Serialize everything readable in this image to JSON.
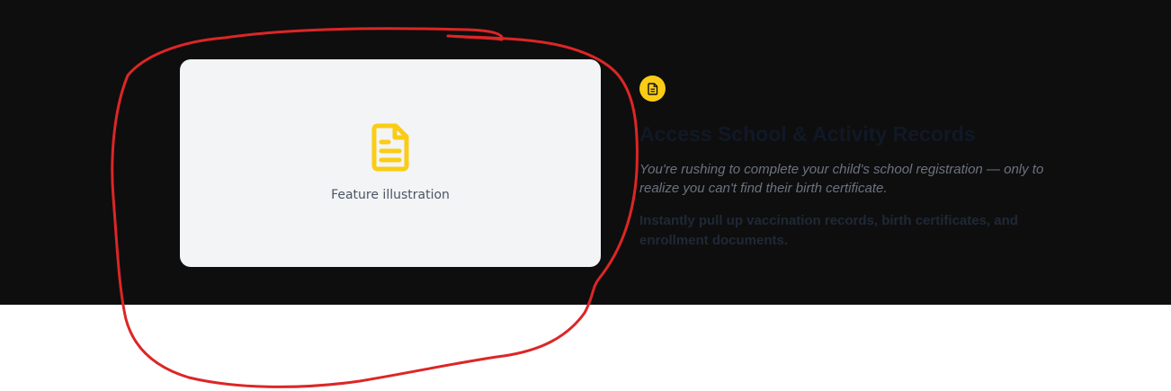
{
  "feature": {
    "illustration_caption": "Feature illustration",
    "title": "Access School & Activity Records",
    "scenario": "You're rushing to complete your child's school registration — only to realize you can't find their birth certificate.",
    "description": "Instantly pull up vaccination records, birth certificates, and enrollment documents.",
    "icon": "document-icon"
  },
  "colors": {
    "section_background": "#0e0e0e",
    "card_background": "#f3f4f6",
    "accent_yellow": "#facc15",
    "annotation_red": "#dc2626"
  }
}
